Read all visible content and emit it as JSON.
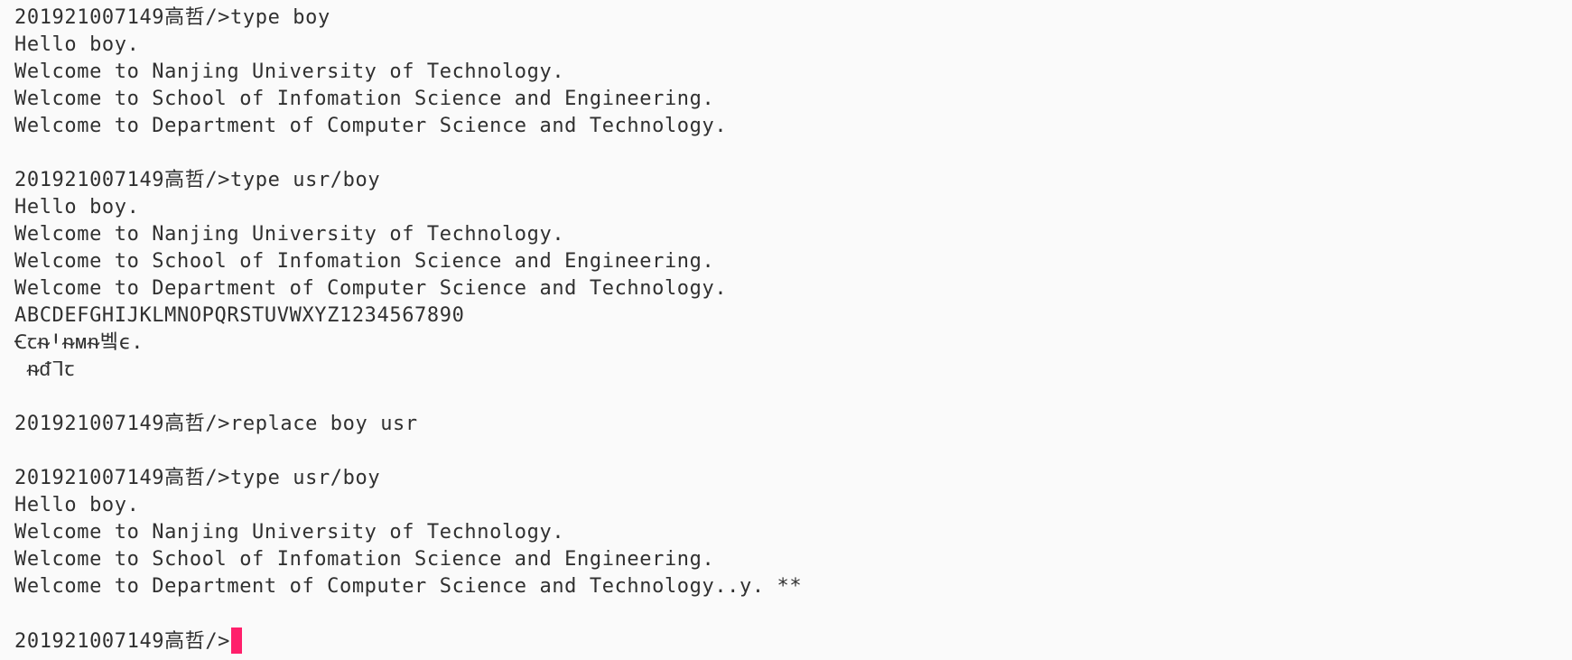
{
  "terminal": {
    "prompt": "201921007149高哲/>",
    "cursor_color": "#ff1f6b",
    "lines": [
      {
        "prompt": "201921007149高哲/>",
        "command": "type boy"
      },
      {
        "text": "Hello boy."
      },
      {
        "text": "Welcome to Nanjing University of Technology."
      },
      {
        "text": "Welcome to School of Infomation Science and Engineering."
      },
      {
        "text": "Welcome to Department of Computer Science and Technology."
      },
      {
        "text": ""
      },
      {
        "prompt": "201921007149高哲/>",
        "command": "type usr/boy"
      },
      {
        "text": "Hello boy."
      },
      {
        "text": "Welcome to Nanjing University of Technology."
      },
      {
        "text": "Welcome to School of Infomation Science and Engineering."
      },
      {
        "text": "Welcome to Department of Computer Science and Technology."
      },
      {
        "text": "ABCDEFGHIJKLMNOPQRSTUVWXYZ1234567890"
      },
      {
        "text": "ꞒꞇᵰꞋᵰᴍᵰ벸ϵ."
      },
      {
        "text": " ᵰᵭᒣꞇ"
      },
      {
        "text": ""
      },
      {
        "prompt": "201921007149高哲/>",
        "command": "replace boy usr"
      },
      {
        "text": ""
      },
      {
        "prompt": "201921007149高哲/>",
        "command": "type usr/boy"
      },
      {
        "text": "Hello boy."
      },
      {
        "text": "Welcome to Nanjing University of Technology."
      },
      {
        "text": "Welcome to School of Infomation Science and Engineering."
      },
      {
        "text": "Welcome to Department of Computer Science and Technology..y. **"
      },
      {
        "text": ""
      },
      {
        "prompt": "201921007149高哲/>",
        "command": "",
        "cursor": true
      }
    ]
  }
}
